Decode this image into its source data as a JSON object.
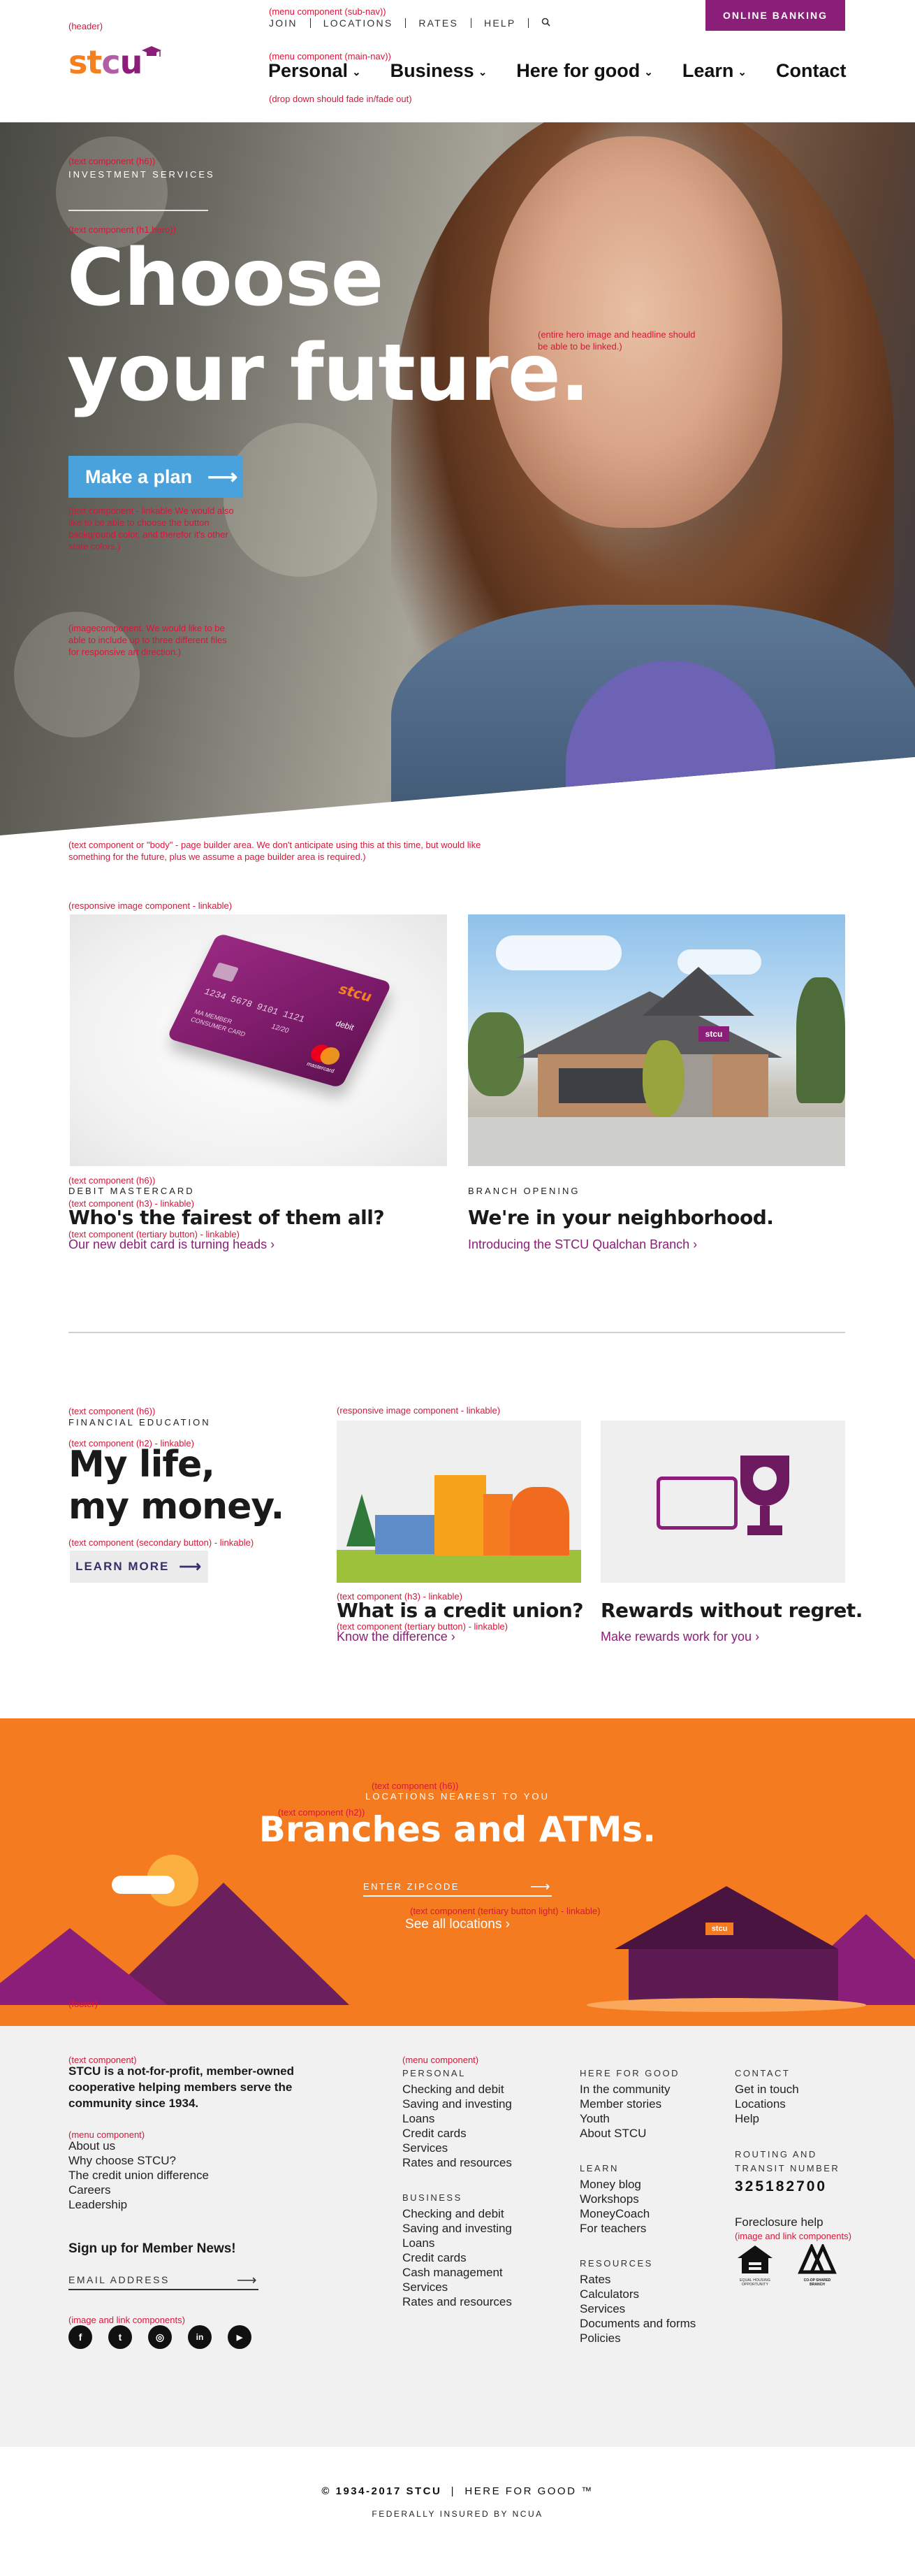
{
  "notes": {
    "header": "(header)",
    "sub_nav": "(menu component (sub-nav))",
    "main_nav": "(menu component (main-nav))",
    "dropdown_fade": "(drop down should fade in/fade out)",
    "hero_h6": "(text component (h6))",
    "hero_h1": "(text component (h1.hero))",
    "hero_linked": "(entire hero image and headline should be able to be linked.)",
    "button_note": "(text component - linkable We would also like to be able to choose the button background color, and therefor it's other state colors.)",
    "image_component": "(imagecomponent. We would like to be able to include up to three different files for responsive art direction.)",
    "body_component": "(text component or \"body\" - page builder area. We don't anticipate using this at this time, but would like something for the future, plus we assume a page builder area is required.)",
    "responsive_image": "(responsive image component - linkable)",
    "card_h6": "(text component (h6))",
    "card_h3": "(text component (h3) - linkable)",
    "card_tertiary": "(text component (tertiary button) - linkable)",
    "fe_h6": "(text component (h6))",
    "fe_h2": "(text component (h2) - linkable)",
    "fe_secondary": "(text component (secondary button) - linkable)",
    "fe_responsive_image": "(responsive image component - linkable)",
    "fe_h3": "(text component (h3) - linkable)",
    "fe_tertiary": "(text component (tertiary button) - linkable)",
    "loc_h6": "(text component (h6))",
    "loc_h2": "(text component (h2))",
    "loc_tertiary_light": "(text component (tertiary button light) - linkable)",
    "footer": "(footer)",
    "f_text": "(text component)",
    "f_menu": "(menu component)",
    "f_menu_main": "(menu component)",
    "f_image_link": "(image and link components)",
    "f_image_link2": "(image and link components)"
  },
  "subnav": {
    "join": "JOIN",
    "locations": "LOCATIONS",
    "rates": "RATES",
    "help": "HELP"
  },
  "online_banking": "ONLINE BANKING",
  "logo": {
    "s": "s",
    "t": "t",
    "c": "c",
    "u": "u"
  },
  "mainnav": {
    "personal": "Personal",
    "business": "Business",
    "here_for_good": "Here for good",
    "learn": "Learn",
    "contact": "Contact"
  },
  "hero": {
    "kicker": "INVESTMENT SERVICES",
    "title_line1": "Choose",
    "title_line2": "your future.",
    "button": "Make a plan"
  },
  "cards": [
    {
      "kicker": "DEBIT MASTERCARD",
      "title": "Who's the fairest of them all?",
      "link": "Our new debit card is turning heads ›"
    },
    {
      "kicker": "BRANCH OPENING",
      "title": "We're in your neighborhood.",
      "link": "Introducing the STCU Qualchan Branch ›"
    }
  ],
  "debit_card": {
    "number": "1234  5678  9101  1121",
    "member": "MA MEMBER",
    "consumer": "CONSUMER CARD",
    "exp": "12/20",
    "brand": "stcu",
    "debit": "debit",
    "mc": "mastercard"
  },
  "branch_sign": "stcu",
  "financial": {
    "kicker": "FINANCIAL EDUCATION",
    "title_line1": "My life,",
    "title_line2": "my money.",
    "button": "LEARN MORE",
    "cards": [
      {
        "title": "What is a credit union?",
        "link": "Know the difference ›"
      },
      {
        "title": "Rewards without regret.",
        "link": "Make rewards work for you ›"
      }
    ]
  },
  "locations": {
    "kicker": "LOCATIONS NEAREST TO YOU",
    "title": "Branches and ATMs.",
    "zip_placeholder": "ENTER ZIPCODE",
    "link": "See all locations ›",
    "branch_sign": "stcu"
  },
  "footer": {
    "about_text": "STCU is a not-for-profit, member-owned cooperative helping members serve the community since 1934.",
    "about_links": [
      "About us",
      "Why choose STCU?",
      "The credit union difference",
      "Careers",
      "Leadership"
    ],
    "signup": "Sign up for Member News!",
    "email_placeholder": "EMAIL ADDRESS",
    "personal_head": "PERSONAL",
    "personal": [
      "Checking and debit",
      "Saving and investing",
      "Loans",
      "Credit cards",
      "Services",
      "Rates and resources"
    ],
    "business_head": "BUSINESS",
    "business": [
      "Checking and debit",
      "Saving and investing",
      "Loans",
      "Credit cards",
      "Cash management",
      "Services",
      "Rates and resources"
    ],
    "good_head": "HERE FOR GOOD",
    "good": [
      "In the community",
      "Member stories",
      "Youth",
      "About STCU"
    ],
    "learn_head": "LEARN",
    "learn": [
      "Money blog",
      "Workshops",
      "MoneyCoach",
      "For teachers"
    ],
    "resources_head": "RESOURCES",
    "resources": [
      "Rates",
      "Calculators",
      "Services",
      "Documents and forms",
      "Policies"
    ],
    "contact_head": "CONTACT",
    "contact": [
      "Get in touch",
      "Locations",
      "Help"
    ],
    "routing_head_1": "ROUTING AND",
    "routing_head_2": "TRANSIT NUMBER",
    "routing_number": "325182700",
    "foreclosure": "Foreclosure help",
    "eho": "EQUAL HOUSING OPPORTUNITY",
    "coop": "CO-OP SHARED BRANCH",
    "socials": {
      "facebook": "f",
      "twitter": "t",
      "instagram": "◎",
      "linkedin": "in",
      "youtube": "▶"
    }
  },
  "copyright": {
    "years": "© 1934-2017 STCU",
    "tagline": "HERE FOR GOOD ™",
    "ncua": "FEDERALLY INSURED BY NCUA"
  }
}
